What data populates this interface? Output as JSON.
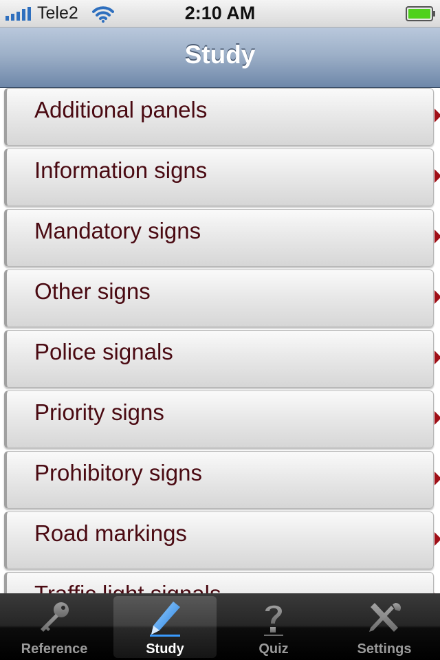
{
  "status_bar": {
    "carrier": "Tele2",
    "time": "2:10 AM",
    "icons": [
      "signal-strength-icon",
      "wifi-icon",
      "battery-icon"
    ]
  },
  "nav": {
    "title": "Study"
  },
  "list": {
    "items": [
      {
        "label": "Additional panels"
      },
      {
        "label": "Information signs"
      },
      {
        "label": "Mandatory signs"
      },
      {
        "label": "Other signs"
      },
      {
        "label": "Police signals"
      },
      {
        "label": "Priority signs"
      },
      {
        "label": "Prohibitory signs"
      },
      {
        "label": "Road markings"
      },
      {
        "label": "Traffic light signals"
      }
    ]
  },
  "tab_bar": {
    "selected": "Study",
    "tabs": [
      {
        "label": "Reference",
        "icon": "key-icon"
      },
      {
        "label": "Study",
        "icon": "pencil-icon"
      },
      {
        "label": "Quiz",
        "icon": "question-mark-icon"
      },
      {
        "label": "Settings",
        "icon": "tools-icon"
      }
    ]
  },
  "colors": {
    "nav_bar": "#8aa0bd",
    "row_text": "#4a0a12",
    "chevron": "#a01018",
    "battery": "#4fd11c"
  }
}
